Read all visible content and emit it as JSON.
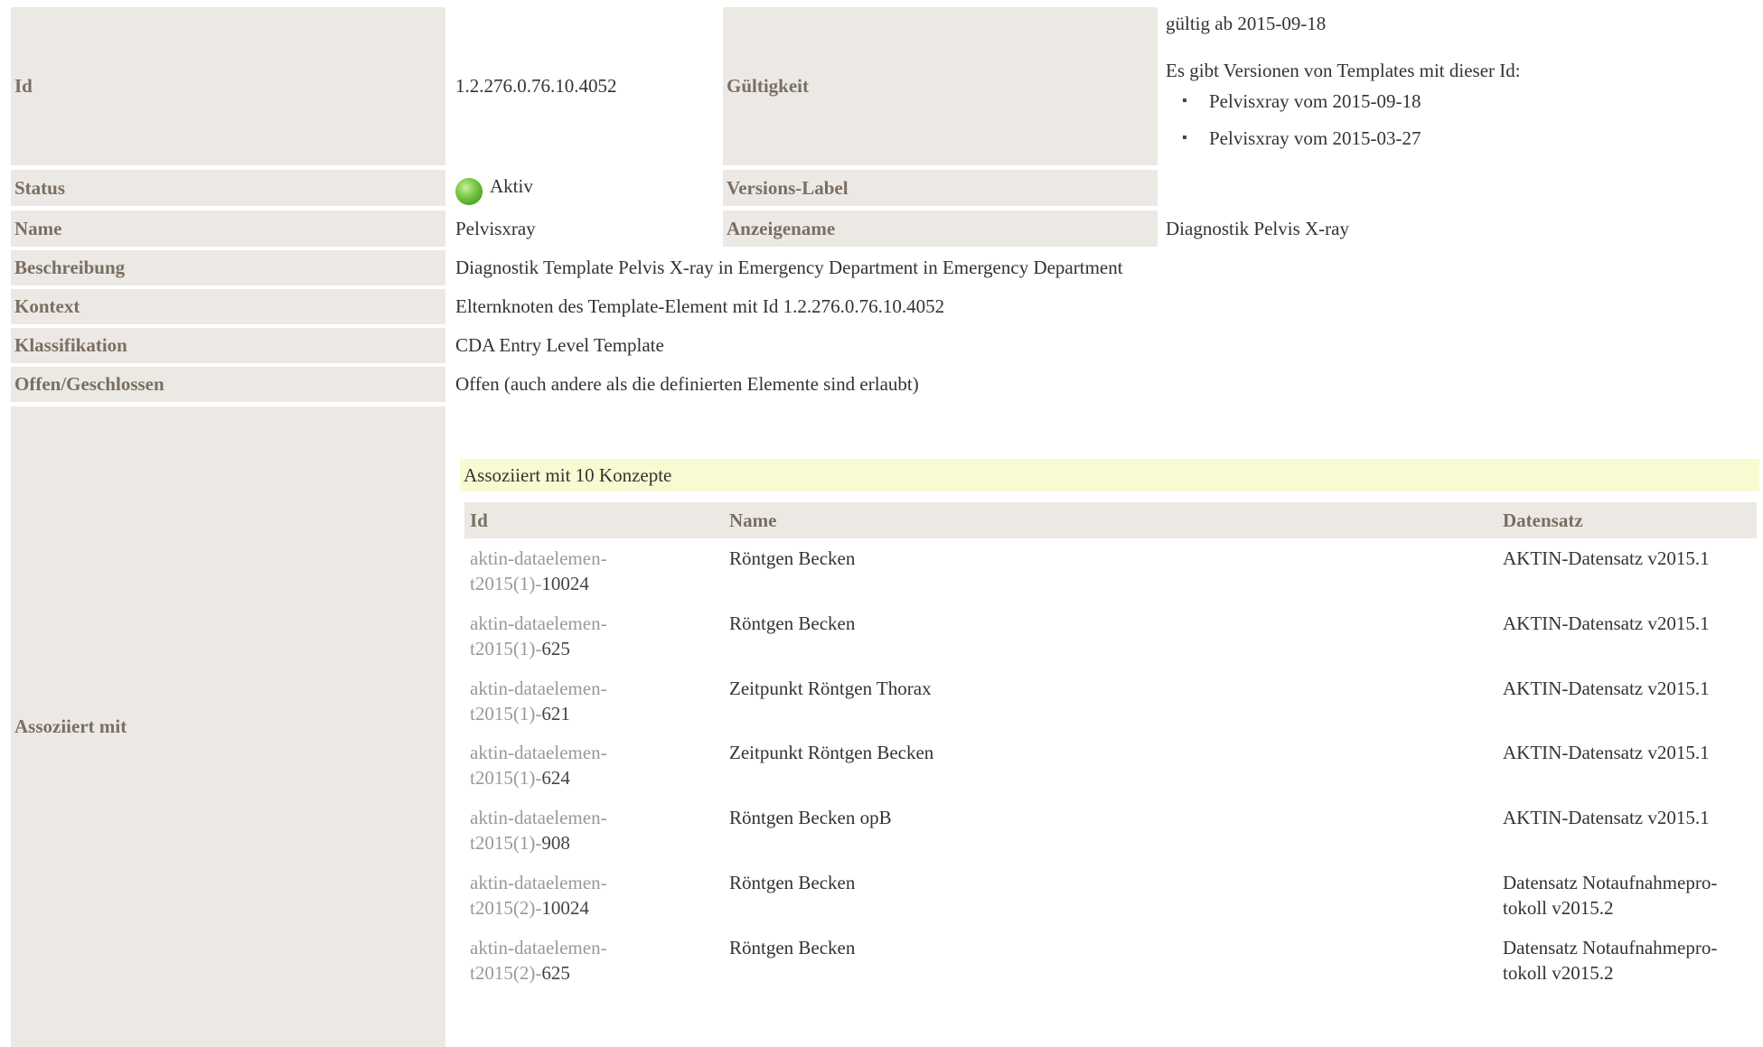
{
  "id_label": "Id",
  "id_value": "1.2.276.0.76.10.4052",
  "validity_label": "Gültigkeit",
  "validity_from": "gültig ab 2015-09-18",
  "validity_intro": "Es gibt Versionen von Templates mit dieser Id:",
  "versions": [
    "Pelvisxray vom 2015-09-18",
    "Pelvisxray vom 2015-03-27"
  ],
  "status_label": "Status",
  "status_value": "Aktiv",
  "status_color": "#5bb52f",
  "version_label_label": "Versions-Label",
  "name_label": "Name",
  "name_value": "Pelvisxray",
  "display_name_label": "Anzeigename",
  "display_name_value": "Diagnostik Pelvis X-ray",
  "description_label": "Beschreibung",
  "description_value": "Diagnostik Template Pelvis X-ray in Emergency Department in Emergency Department",
  "context_label": "Kontext",
  "context_value": "Elternknoten des Template-Element mit Id 1.2.276.0.76.10.4052",
  "classification_label": "Klassifikation",
  "classification_value": "CDA Entry Level Template",
  "open_closed_label": "Offen/Geschlossen",
  "open_closed_value": "Offen (auch andere als die definierten Elemente sind erlaubt)",
  "associated_label": "Assoziiert mit",
  "associated_heading": "Assoziiert mit 10 Konzepte",
  "table_headers": {
    "id": "Id",
    "name": "Name",
    "dataset": "Datensatz"
  },
  "concepts": [
    {
      "id_prefix_1": "aktin-dataelemen-",
      "id_prefix_2": "t2015(1)-",
      "id_num": "10024",
      "name": "Röntgen Becken",
      "dataset_1": "AKTIN-Datensatz v2015.1",
      "dataset_2": ""
    },
    {
      "id_prefix_1": "aktin-dataelemen-",
      "id_prefix_2": "t2015(1)-",
      "id_num": "625",
      "name": "Röntgen Becken",
      "dataset_1": "AKTIN-Datensatz v2015.1",
      "dataset_2": ""
    },
    {
      "id_prefix_1": "aktin-dataelemen-",
      "id_prefix_2": "t2015(1)-",
      "id_num": "621",
      "name": "Zeitpunkt Röntgen Thorax",
      "dataset_1": "AKTIN-Datensatz v2015.1",
      "dataset_2": ""
    },
    {
      "id_prefix_1": "aktin-dataelemen-",
      "id_prefix_2": "t2015(1)-",
      "id_num": "624",
      "name": "Zeitpunkt Röntgen Becken",
      "dataset_1": "AKTIN-Datensatz v2015.1",
      "dataset_2": ""
    },
    {
      "id_prefix_1": "aktin-dataelemen-",
      "id_prefix_2": "t2015(1)-",
      "id_num": "908",
      "name": "Röntgen Becken opB",
      "dataset_1": "AKTIN-Datensatz v2015.1",
      "dataset_2": ""
    },
    {
      "id_prefix_1": "aktin-dataelemen-",
      "id_prefix_2": "t2015(2)-",
      "id_num": "10024",
      "name": "Röntgen Becken",
      "dataset_1": "Datensatz Notaufnahmepro-",
      "dataset_2": "tokoll v2015.2"
    },
    {
      "id_prefix_1": "aktin-dataelemen-",
      "id_prefix_2": "t2015(2)-",
      "id_num": "625",
      "name": "Röntgen Becken",
      "dataset_1": "Datensatz Notaufnahmepro-",
      "dataset_2": "tokoll v2015.2"
    }
  ]
}
